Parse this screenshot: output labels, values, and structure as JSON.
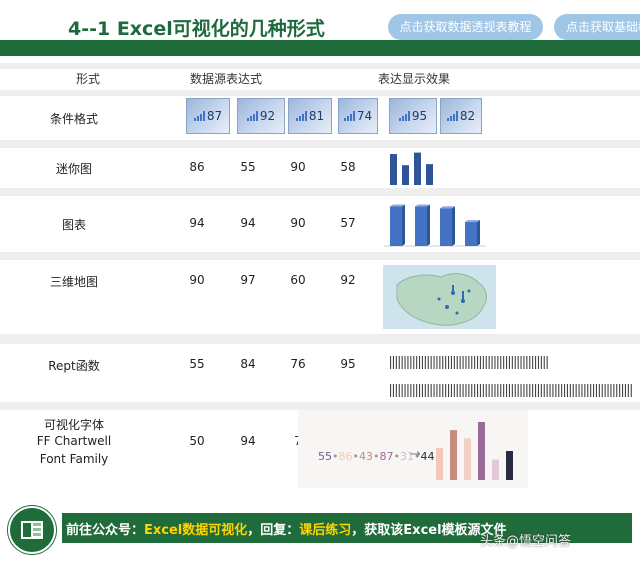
{
  "header": {
    "title": "4--1    Excel可视化的几种形式",
    "buttons": [
      "点击获取数据透视表教程",
      "点击获取基础教"
    ]
  },
  "table": {
    "columns": [
      "形式",
      "数据源表达式",
      "表达显示效果"
    ],
    "rows": [
      {
        "label": "条件格式",
        "values": [
          87,
          92,
          81,
          74,
          95,
          82
        ]
      },
      {
        "label": "迷你图",
        "values": [
          86,
          55,
          90,
          58
        ]
      },
      {
        "label": "图表",
        "values": [
          94,
          94,
          90,
          57
        ]
      },
      {
        "label": "三维地图",
        "values": [
          90,
          97,
          60,
          92
        ]
      },
      {
        "label": "Rept函数",
        "values": [
          55,
          84,
          76,
          95
        ]
      },
      {
        "label_lines": [
          "可视化字体",
          "FF Chartwell",
          "Font Family"
        ],
        "values": [
          50,
          94,
          "7"
        ]
      }
    ]
  },
  "sparkline_bars": [
    86,
    55,
    90,
    58
  ],
  "chart_bars": [
    94,
    94,
    90,
    57
  ],
  "rept_counts": [
    55,
    84
  ],
  "font_demo": {
    "sequence": [
      {
        "text": "55",
        "color": "#7a5a8a"
      },
      {
        "text": "•",
        "color": "#999999"
      },
      {
        "text": "86",
        "color": "#f3c8b8"
      },
      {
        "text": "•",
        "color": "#999999"
      },
      {
        "text": "43",
        "color": "#c78a7e"
      },
      {
        "text": "•",
        "color": "#999999"
      },
      {
        "text": "87",
        "color": "#9a6b98"
      },
      {
        "text": "•",
        "color": "#999999"
      },
      {
        "text": "31",
        "color": "#d9b7cf"
      },
      {
        "text": "•",
        "color": "#999999"
      },
      {
        "text": "44",
        "color": "#2a2a40"
      }
    ],
    "arrow": "→",
    "bars": [
      {
        "value": 55,
        "color": "#f3c8b8"
      },
      {
        "value": 86,
        "color": "#c78a7e"
      },
      {
        "value": 72,
        "color": "#f0d0c4"
      },
      {
        "value": 100,
        "color": "#9a6b98"
      },
      {
        "value": 35,
        "color": "#e3c6d8"
      },
      {
        "value": 50,
        "color": "#2a2a40"
      }
    ]
  },
  "footer": {
    "prefix": "前往公众号：",
    "account": "Excel数据可视化",
    "mid": "，回复：",
    "keyword": "课后练习",
    "suffix": "，获取该Excel模板源文件",
    "watermark": "头条@悟空问答"
  },
  "colors": {
    "brand_green": "#1f6b3a",
    "accent_blue": "#4472c4",
    "pill_blue": "#9fc6e7"
  }
}
